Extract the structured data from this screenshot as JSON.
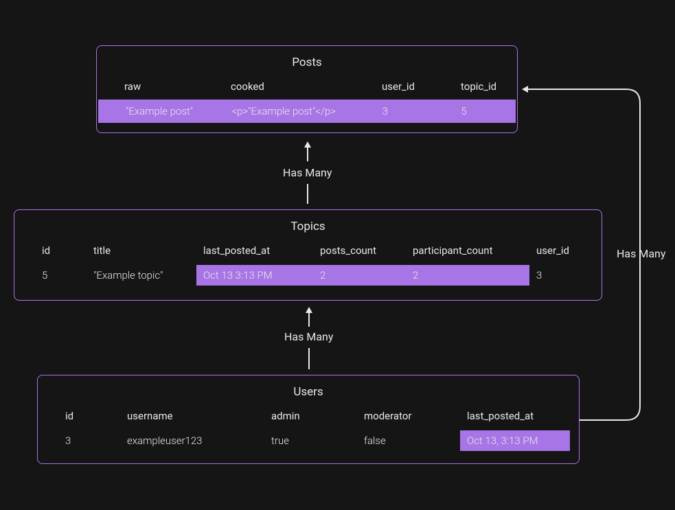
{
  "entities": {
    "posts": {
      "title": "Posts",
      "columns": [
        "raw",
        "cooked",
        "user_id",
        "topic_id"
      ],
      "row": {
        "raw": "\"Example post\"",
        "cooked": "<p>\"Example post\"</p>",
        "user_id": "3",
        "topic_id": "5"
      }
    },
    "topics": {
      "title": "Topics",
      "columns": [
        "id",
        "title",
        "last_posted_at",
        "posts_count",
        "participant_count",
        "user_id"
      ],
      "row": {
        "id": "5",
        "title": "\"Example topic\"",
        "last_posted_at": "Oct 13 3:13 PM",
        "posts_count": "2",
        "participant_count": "2",
        "user_id": "3"
      }
    },
    "users": {
      "title": "Users",
      "columns": [
        "id",
        "username",
        "admin",
        "moderator",
        "last_posted_at"
      ],
      "row": {
        "id": "3",
        "username": "exampleuser123",
        "admin": "true",
        "moderator": "false",
        "last_posted_at": "Oct 13, 3:13 PM"
      }
    }
  },
  "relations": {
    "topics_posts": "Has Many",
    "users_topics": "Has Many",
    "users_posts": "Has Many"
  }
}
